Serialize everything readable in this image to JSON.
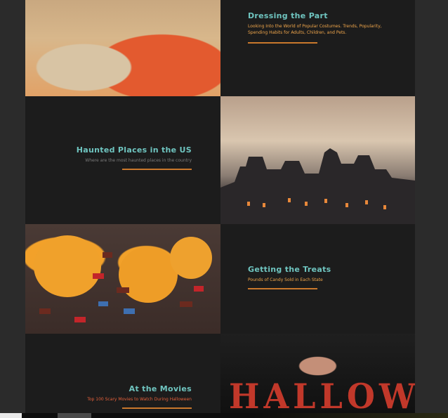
{
  "articles": [
    {
      "title": "Dressing the Part",
      "subtitle": "Looking Into the World of Popular Costumes. Trends, Popularity, Spending Habits for Adults, Children, and Pets."
    },
    {
      "title": "Haunted Places in the US",
      "subtitle": "Where are the most haunted places in the country"
    },
    {
      "title": "Getting the Treats",
      "subtitle": "Pounds of Candy Sold in Each State"
    },
    {
      "title": "At the Movies",
      "subtitle": "Top 100 Scary Movies to Watch During Halloween"
    }
  ],
  "images": {
    "movie_poster_text": "HALLOWEEN"
  },
  "colors": {
    "background": "#1c1c1c",
    "title_teal": "#6fc5c0",
    "accent_orange": "#f0a64b",
    "divider_orange": "#c9782c",
    "subtitle_grey": "#7b7b7b",
    "subtitle_red": "#e5603a"
  }
}
